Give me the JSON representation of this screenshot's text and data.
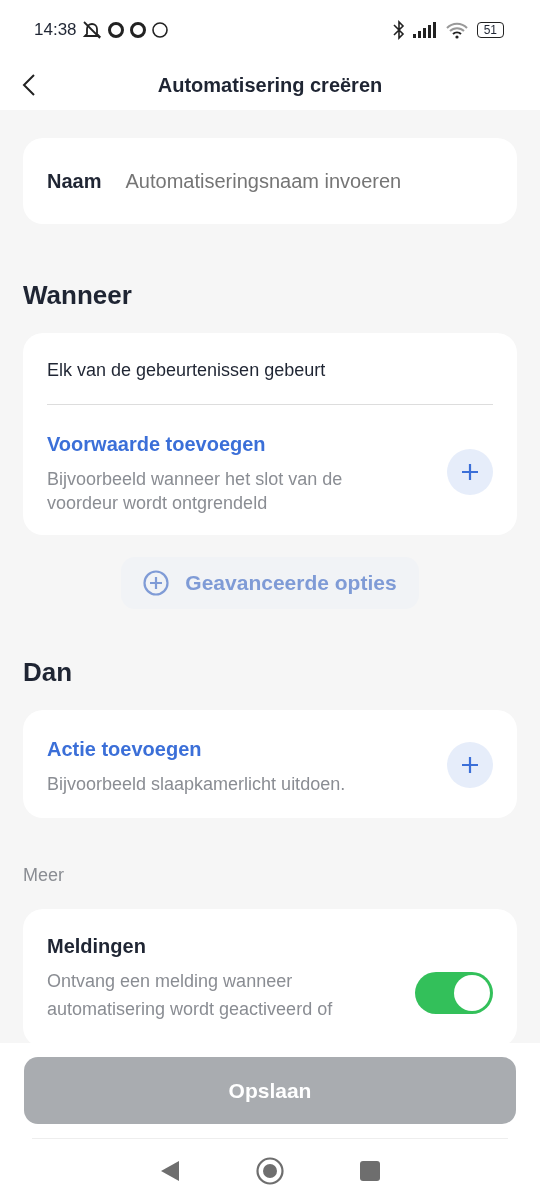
{
  "status_bar": {
    "time": "14:38",
    "battery": "51"
  },
  "header": {
    "title": "Automatisering creëren"
  },
  "name_field": {
    "label": "Naam",
    "placeholder": "Automatiseringsnaam invoeren"
  },
  "when": {
    "heading": "Wanneer",
    "trigger": "Elk van de gebeurtenissen gebeurt",
    "add": {
      "title": "Voorwaarde toevoegen",
      "hint": "Bijvoorbeeld wanneer het slot van de voordeur wordt ontgrendeld"
    }
  },
  "advanced": {
    "label": "Geavanceerde opties",
    "disabled": true
  },
  "then": {
    "heading": "Dan",
    "add": {
      "title": "Actie toevoegen",
      "hint": "Bijvoorbeeld slaapkamerlicht uitdoen."
    }
  },
  "more": {
    "heading": "Meer",
    "items": [
      {
        "title": "Meldingen",
        "description": "Ontvang een melding wanneer automatisering wordt geactiveerd of",
        "on": true
      }
    ]
  },
  "save_button": {
    "label": "Opslaan",
    "disabled": true
  }
}
